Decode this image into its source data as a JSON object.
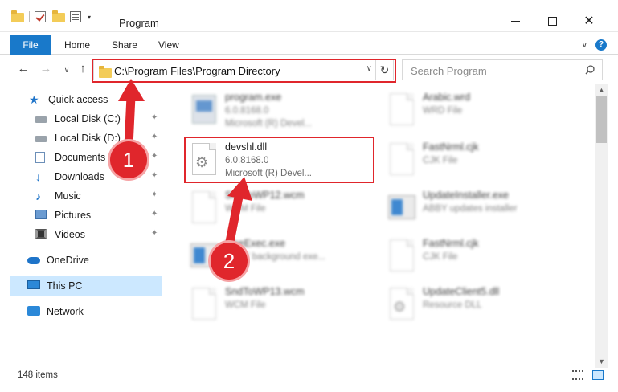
{
  "window": {
    "title": "Program",
    "min_glyph": "",
    "max_glyph": "",
    "close_glyph": "✕"
  },
  "ribbon": {
    "tabs": [
      {
        "label": "File"
      },
      {
        "label": "Home"
      },
      {
        "label": "Share"
      },
      {
        "label": "View"
      }
    ],
    "expand_glyph": "∨",
    "help_glyph": "?"
  },
  "navigation": {
    "back_glyph": "←",
    "forward_glyph": "→",
    "recent_glyph": "∨",
    "up_glyph": "↑",
    "address": "C:\\Program Files\\Program Directory",
    "address_dropdown_glyph": "∨",
    "refresh_glyph": "↻",
    "search_placeholder": "Search Program"
  },
  "sidebar": {
    "items": [
      {
        "label": "Quick access"
      },
      {
        "label": "Local Disk (C:)"
      },
      {
        "label": "Local Disk (D:)"
      },
      {
        "label": "Documents"
      },
      {
        "label": "Downloads"
      },
      {
        "label": "Music"
      },
      {
        "label": "Pictures"
      },
      {
        "label": "Videos"
      },
      {
        "label": "OneDrive"
      },
      {
        "label": "This PC"
      },
      {
        "label": "Network"
      }
    ],
    "pin_glyph": "📌"
  },
  "files": [
    {
      "name": "program.exe",
      "line2": "6.0.8168.0",
      "line3": "Microsoft (R) Devel..."
    },
    {
      "name": "Arabic.wrd",
      "line2": "WRD File",
      "line3": ""
    },
    {
      "name": "devshl.dll",
      "line2": "6.0.8168.0",
      "line3": "Microsoft (R) Devel..."
    },
    {
      "name": "FastNrml.cjk",
      "line2": "CJK File",
      "line3": ""
    },
    {
      "name": "SndToWP12.wcm",
      "line2": "WCM File",
      "line3": ""
    },
    {
      "name": "UpdateInstaller.exe",
      "line2": "ABBY updates installer",
      "line3": ""
    },
    {
      "name": "OneExec.exe",
      "line2": "ABBY background exe...",
      "line3": ""
    },
    {
      "name": "FastNrml.cjk",
      "line2": "CJK File",
      "line3": ""
    },
    {
      "name": "SndToWP13.wcm",
      "line2": "WCM File",
      "line3": ""
    },
    {
      "name": "UpdateClient5.dll",
      "line2": "Resource DLL",
      "line3": ""
    }
  ],
  "scrollbar": {
    "up_glyph": "▲",
    "down_glyph": "▼"
  },
  "status": {
    "item_count": "148 items"
  },
  "callouts": [
    {
      "label": "1"
    },
    {
      "label": "2"
    }
  ],
  "colors": {
    "accent": "#1979ca",
    "highlight": "#e0262c",
    "selection": "#cce8ff"
  }
}
